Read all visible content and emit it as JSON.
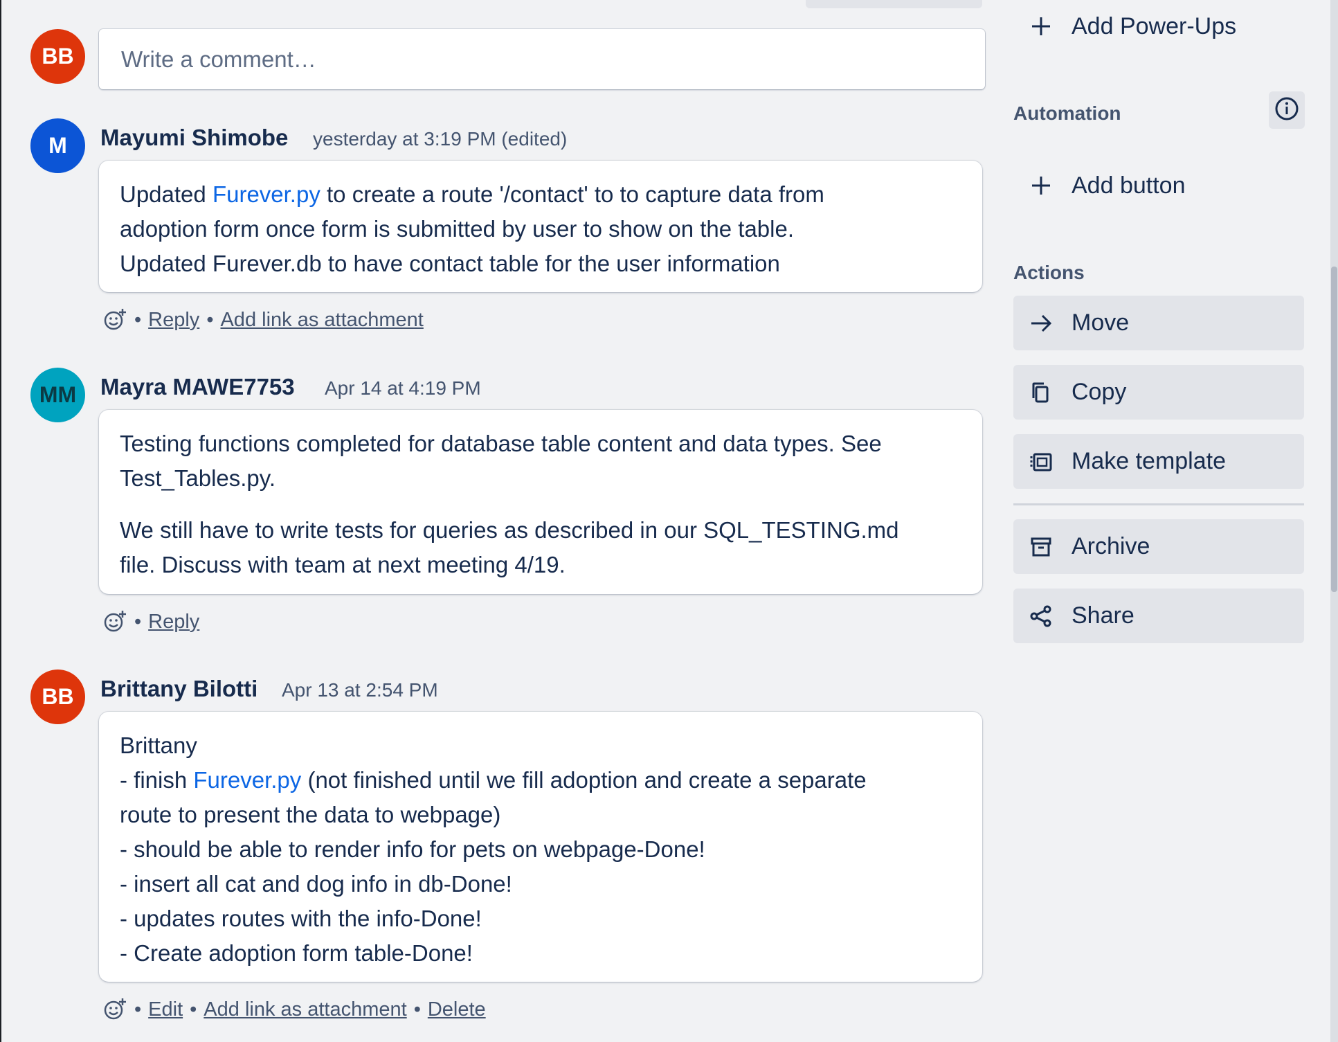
{
  "colors": {
    "modal_bg": "#f1f2f4",
    "text": "#172b4d",
    "muted": "#44546f",
    "link": "#0c66e4",
    "avatar_bb": "#de350b",
    "avatar_m": "#0c55d6",
    "avatar_mm": "#00a3bf",
    "side_button_bg": "#e2e4e9"
  },
  "composer": {
    "avatar_initials": "BB",
    "placeholder": "Write a comment…"
  },
  "comments": [
    {
      "avatar_initials": "M",
      "author": "Mayumi Shimobe",
      "timestamp": "yesterday at 3:19 PM (edited)",
      "lines": {
        "l1_pre": "Updated ",
        "l1_link": "Furever.py",
        "l1_post": " to create a route '/contact' to to capture data from",
        "l2": "adoption form once form is submitted by user to show on the table.",
        "l3": "Updated Furever.db to have contact table for the user information"
      },
      "actions": {
        "reply": "Reply",
        "add_link": "Add link as attachment"
      }
    },
    {
      "avatar_initials": "MM",
      "author": "Mayra MAWE7753",
      "timestamp": "Apr 14 at 4:19 PM",
      "lines": {
        "l1": "Testing functions completed for database table content and data types. See",
        "l2": "Test_Tables.py.",
        "l3": "We still have to write tests for queries as described in our SQL_TESTING.md",
        "l4": "file. Discuss with team at next meeting 4/19."
      },
      "actions": {
        "reply": "Reply"
      }
    },
    {
      "avatar_initials": "BB",
      "author": "Brittany Bilotti",
      "timestamp": "Apr 13 at 2:54 PM",
      "lines": {
        "l1": "Brittany",
        "l2_pre": "- finish ",
        "l2_link": "Furever.py",
        "l2_post": " (not finished until we fill adoption and create a separate",
        "l3": "route to present the data to webpage)",
        "l4": "- should be able to render info for pets on webpage-Done!",
        "l5": "- insert all cat and dog info in db-Done!",
        "l6": "- updates routes with the info-Done!",
        "l7": "- Create adoption form table-Done!"
      },
      "actions": {
        "edit": "Edit",
        "add_link": "Add link as attachment",
        "delete": "Delete"
      }
    }
  ],
  "separator": "•",
  "sidebar": {
    "add_power_ups": "Add Power-Ups",
    "automation_heading": "Automation",
    "info_icon": "info-icon",
    "add_button": "Add button",
    "actions_heading": "Actions",
    "buttons": [
      {
        "label": "Move",
        "icon": "arrow-right-icon"
      },
      {
        "label": "Copy",
        "icon": "copy-icon"
      },
      {
        "label": "Make template",
        "icon": "template-icon"
      },
      {
        "label": "Archive",
        "icon": "archive-icon"
      },
      {
        "label": "Share",
        "icon": "share-icon"
      }
    ]
  }
}
